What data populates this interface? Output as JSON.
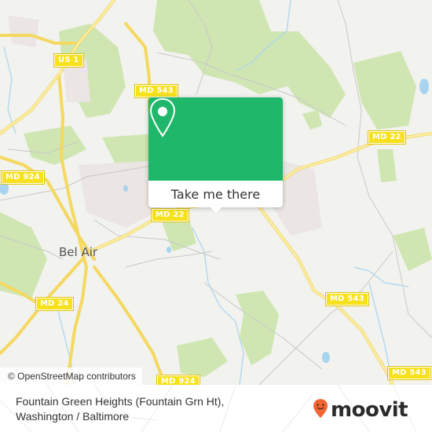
{
  "map": {
    "road_shields": [
      {
        "id": "us1",
        "label": "US 1"
      },
      {
        "id": "md543-top",
        "label": "MD 543"
      },
      {
        "id": "md22-right",
        "label": "MD 22"
      },
      {
        "id": "md924",
        "label": "MD 924"
      },
      {
        "id": "md22-center",
        "label": "MD 22"
      },
      {
        "id": "md543-mid",
        "label": "MD 543"
      },
      {
        "id": "md24",
        "label": "MD 24"
      },
      {
        "id": "md543-bottom",
        "label": "MD 543"
      },
      {
        "id": "md924-bottom",
        "label": "MD 924"
      }
    ],
    "town_label": "Bel Air",
    "attribution": "© OpenStreetMap contributors",
    "colors": {
      "background": "#f2f2ee",
      "park": "#c8e3a8",
      "road": "#f7e36a",
      "water": "#a8d4f0"
    }
  },
  "popup": {
    "icon": "map-pin-icon",
    "button_label": "Take me there",
    "accent": "#1fb86b"
  },
  "footer": {
    "line1": "Fountain Green Heights (Fountain Grn Ht),",
    "line2": "Washington / Baltimore",
    "brand": "moovit",
    "brand_color": "#f26532"
  }
}
